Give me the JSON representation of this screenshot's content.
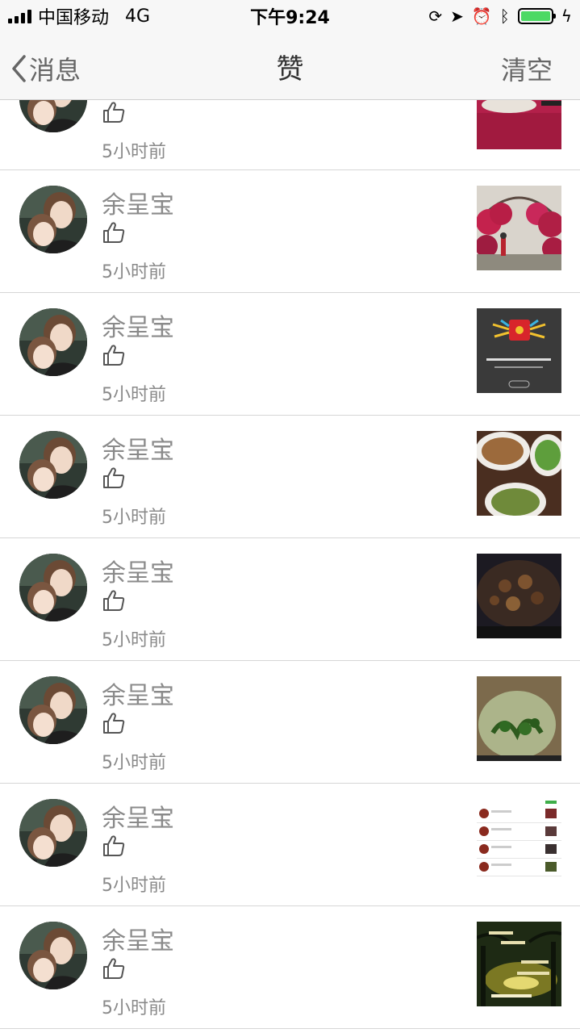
{
  "status_bar": {
    "carrier": "中国移动",
    "network": "4G",
    "time": "下午9:24"
  },
  "nav": {
    "back_label": "消息",
    "title": "赞",
    "clear_label": "清空"
  },
  "items": [
    {
      "name": "",
      "time": "5小时前",
      "thumb": "restaurant-table-photo"
    },
    {
      "name": "余呈宝",
      "time": "5小时前",
      "thumb": "flower-arch-photo"
    },
    {
      "name": "余呈宝",
      "time": "5小时前",
      "thumb": "red-envelope-screenshot"
    },
    {
      "name": "余呈宝",
      "time": "5小时前",
      "thumb": "dishes-photo"
    },
    {
      "name": "余呈宝",
      "time": "5小时前",
      "thumb": "stew-pot-photo"
    },
    {
      "name": "余呈宝",
      "time": "5小时前",
      "thumb": "herbs-jar-photo"
    },
    {
      "name": "余呈宝",
      "time": "5小时前",
      "thumb": "app-list-screenshot"
    },
    {
      "name": "余呈宝",
      "time": "5小时前",
      "thumb": "good-night-card"
    }
  ],
  "colors": {
    "battery": "#4cd964",
    "bar_bg": "#f7f7f7",
    "text_gray": "#8a8a8a"
  }
}
